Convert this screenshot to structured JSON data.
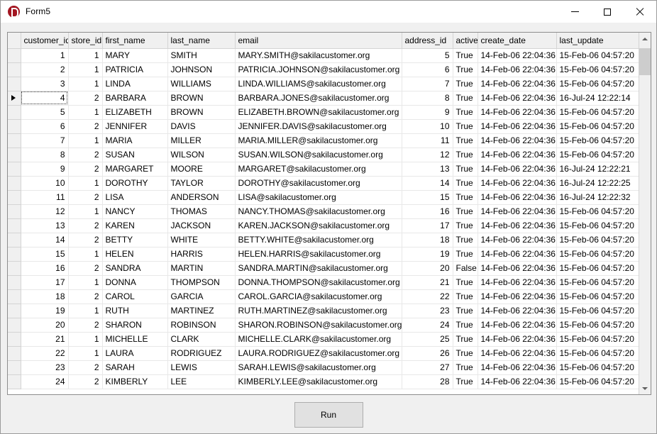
{
  "window": {
    "title": "Form5",
    "icon": "app-logo-icon",
    "controls": {
      "minimize": "minimize-icon",
      "maximize": "maximize-icon",
      "close": "close-icon"
    }
  },
  "grid": {
    "columns": [
      "customer_id",
      "store_id",
      "first_name",
      "last_name",
      "email",
      "address_id",
      "active",
      "create_date",
      "last_update"
    ],
    "selected_row_index": 3,
    "selected_column": "customer_id",
    "rows": [
      [
        "1",
        "1",
        "MARY",
        "SMITH",
        "MARY.SMITH@sakilacustomer.org",
        "5",
        "True",
        "14-Feb-06 22:04:36",
        "15-Feb-06 04:57:20"
      ],
      [
        "2",
        "1",
        "PATRICIA",
        "JOHNSON",
        "PATRICIA.JOHNSON@sakilacustomer.org",
        "6",
        "True",
        "14-Feb-06 22:04:36",
        "15-Feb-06 04:57:20"
      ],
      [
        "3",
        "1",
        "LINDA",
        "WILLIAMS",
        "LINDA.WILLIAMS@sakilacustomer.org",
        "7",
        "True",
        "14-Feb-06 22:04:36",
        "15-Feb-06 04:57:20"
      ],
      [
        "4",
        "2",
        "BARBARA",
        "BROWN",
        "BARBARA.JONES@sakilacustomer.org",
        "8",
        "True",
        "14-Feb-06 22:04:36",
        "16-Jul-24 12:22:14"
      ],
      [
        "5",
        "1",
        "ELIZABETH",
        "BROWN",
        "ELIZABETH.BROWN@sakilacustomer.org",
        "9",
        "True",
        "14-Feb-06 22:04:36",
        "15-Feb-06 04:57:20"
      ],
      [
        "6",
        "2",
        "JENNIFER",
        "DAVIS",
        "JENNIFER.DAVIS@sakilacustomer.org",
        "10",
        "True",
        "14-Feb-06 22:04:36",
        "15-Feb-06 04:57:20"
      ],
      [
        "7",
        "1",
        "MARIA",
        "MILLER",
        "MARIA.MILLER@sakilacustomer.org",
        "11",
        "True",
        "14-Feb-06 22:04:36",
        "15-Feb-06 04:57:20"
      ],
      [
        "8",
        "2",
        "SUSAN",
        "WILSON",
        "SUSAN.WILSON@sakilacustomer.org",
        "12",
        "True",
        "14-Feb-06 22:04:36",
        "15-Feb-06 04:57:20"
      ],
      [
        "9",
        "2",
        "MARGARET",
        "MOORE",
        "MARGARET@sakilacustomer.org",
        "13",
        "True",
        "14-Feb-06 22:04:36",
        "16-Jul-24 12:22:21"
      ],
      [
        "10",
        "1",
        "DOROTHY",
        "TAYLOR",
        "DOROTHY@sakilacustomer.org",
        "14",
        "True",
        "14-Feb-06 22:04:36",
        "16-Jul-24 12:22:25"
      ],
      [
        "11",
        "2",
        "LISA",
        "ANDERSON",
        "LISA@sakilacustomer.org",
        "15",
        "True",
        "14-Feb-06 22:04:36",
        "16-Jul-24 12:22:32"
      ],
      [
        "12",
        "1",
        "NANCY",
        "THOMAS",
        "NANCY.THOMAS@sakilacustomer.org",
        "16",
        "True",
        "14-Feb-06 22:04:36",
        "15-Feb-06 04:57:20"
      ],
      [
        "13",
        "2",
        "KAREN",
        "JACKSON",
        "KAREN.JACKSON@sakilacustomer.org",
        "17",
        "True",
        "14-Feb-06 22:04:36",
        "15-Feb-06 04:57:20"
      ],
      [
        "14",
        "2",
        "BETTY",
        "WHITE",
        "BETTY.WHITE@sakilacustomer.org",
        "18",
        "True",
        "14-Feb-06 22:04:36",
        "15-Feb-06 04:57:20"
      ],
      [
        "15",
        "1",
        "HELEN",
        "HARRIS",
        "HELEN.HARRIS@sakilacustomer.org",
        "19",
        "True",
        "14-Feb-06 22:04:36",
        "15-Feb-06 04:57:20"
      ],
      [
        "16",
        "2",
        "SANDRA",
        "MARTIN",
        "SANDRA.MARTIN@sakilacustomer.org",
        "20",
        "False",
        "14-Feb-06 22:04:36",
        "15-Feb-06 04:57:20"
      ],
      [
        "17",
        "1",
        "DONNA",
        "THOMPSON",
        "DONNA.THOMPSON@sakilacustomer.org",
        "21",
        "True",
        "14-Feb-06 22:04:36",
        "15-Feb-06 04:57:20"
      ],
      [
        "18",
        "2",
        "CAROL",
        "GARCIA",
        "CAROL.GARCIA@sakilacustomer.org",
        "22",
        "True",
        "14-Feb-06 22:04:36",
        "15-Feb-06 04:57:20"
      ],
      [
        "19",
        "1",
        "RUTH",
        "MARTINEZ",
        "RUTH.MARTINEZ@sakilacustomer.org",
        "23",
        "True",
        "14-Feb-06 22:04:36",
        "15-Feb-06 04:57:20"
      ],
      [
        "20",
        "2",
        "SHARON",
        "ROBINSON",
        "SHARON.ROBINSON@sakilacustomer.org",
        "24",
        "True",
        "14-Feb-06 22:04:36",
        "15-Feb-06 04:57:20"
      ],
      [
        "21",
        "1",
        "MICHELLE",
        "CLARK",
        "MICHELLE.CLARK@sakilacustomer.org",
        "25",
        "True",
        "14-Feb-06 22:04:36",
        "15-Feb-06 04:57:20"
      ],
      [
        "22",
        "1",
        "LAURA",
        "RODRIGUEZ",
        "LAURA.RODRIGUEZ@sakilacustomer.org",
        "26",
        "True",
        "14-Feb-06 22:04:36",
        "15-Feb-06 04:57:20"
      ],
      [
        "23",
        "2",
        "SARAH",
        "LEWIS",
        "SARAH.LEWIS@sakilacustomer.org",
        "27",
        "True",
        "14-Feb-06 22:04:36",
        "15-Feb-06 04:57:20"
      ],
      [
        "24",
        "2",
        "KIMBERLY",
        "LEE",
        "KIMBERLY.LEE@sakilacustomer.org",
        "28",
        "True",
        "14-Feb-06 22:04:36",
        "15-Feb-06 04:57:20"
      ]
    ],
    "scrollbar": {
      "up_icon": "scroll-up-icon",
      "down_icon": "scroll-down-icon"
    }
  },
  "footer": {
    "run_label": "Run"
  },
  "colors": {
    "selection": "#a8d4f5",
    "accent": "#a31621",
    "header_bg": "#f0f0f0"
  }
}
